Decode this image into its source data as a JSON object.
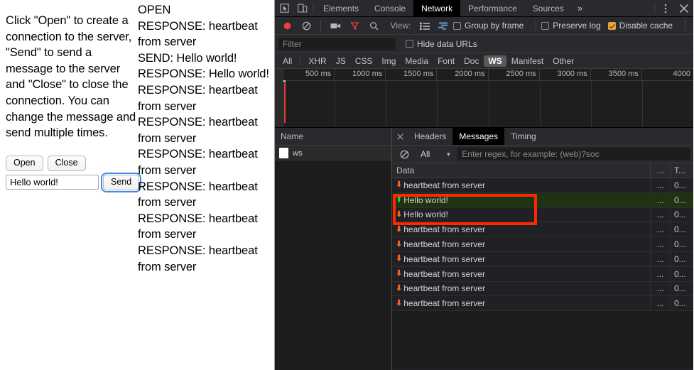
{
  "webpage": {
    "instructions": "Click \"Open\" to create a connection to the server, \"Send\" to send a message to the server and \"Close\" to close the connection. You can change the message and send multiple times.",
    "buttons": {
      "open": "Open",
      "close": "Close",
      "send": "Send"
    },
    "message_input": {
      "value": "Hello world!",
      "placeholder": ""
    },
    "log_lines": [
      "OPEN",
      "RESPONSE: heartbeat from server",
      "SEND: Hello world!",
      "RESPONSE: Hello world!",
      "RESPONSE: heartbeat from server",
      "RESPONSE: heartbeat from server",
      "RESPONSE: heartbeat from server",
      "RESPONSE: heartbeat from server",
      "RESPONSE: heartbeat from server",
      "RESPONSE: heartbeat from server"
    ]
  },
  "devtools": {
    "main_tabs": [
      {
        "label": "Elements",
        "active": false
      },
      {
        "label": "Console",
        "active": false
      },
      {
        "label": "Network",
        "active": true
      },
      {
        "label": "Performance",
        "active": false
      },
      {
        "label": "Sources",
        "active": false
      }
    ],
    "more_tabs_label": "»",
    "icons": {
      "inspect": "inspect-element-icon",
      "device": "device-toolbar-icon",
      "menu": "kebab-menu-icon",
      "close": "close-devtools-icon",
      "record": "record-icon",
      "clear": "clear-icon",
      "screenshot": "camera-icon",
      "filter": "filter-icon",
      "search": "search-icon"
    },
    "toolbar": {
      "view_label": "View:",
      "group_by_frame": {
        "label": "Group by frame",
        "checked": false
      },
      "preserve_log": {
        "label": "Preserve log",
        "checked": false
      },
      "disable_cache": {
        "label": "Disable cache",
        "checked": true
      }
    },
    "filter": {
      "placeholder": "Filter",
      "value": "",
      "hide_data_urls": {
        "label": "Hide data URLs",
        "checked": false
      }
    },
    "resource_types": [
      {
        "label": "All",
        "active": false
      },
      {
        "label": "XHR",
        "active": false
      },
      {
        "label": "JS",
        "active": false
      },
      {
        "label": "CSS",
        "active": false
      },
      {
        "label": "Img",
        "active": false
      },
      {
        "label": "Media",
        "active": false
      },
      {
        "label": "Font",
        "active": false
      },
      {
        "label": "Doc",
        "active": false
      },
      {
        "label": "WS",
        "active": true
      },
      {
        "label": "Manifest",
        "active": false
      },
      {
        "label": "Other",
        "active": false
      }
    ],
    "overview_ticks": [
      "500 ms",
      "1000 ms",
      "1500 ms",
      "2000 ms",
      "2500 ms",
      "3000 ms",
      "3500 ms",
      "4000"
    ],
    "requests_panel": {
      "column_header": "Name",
      "rows": [
        {
          "name": "ws",
          "selected": true
        }
      ]
    },
    "detail_panel": {
      "tabs": [
        {
          "label": "Headers",
          "active": false
        },
        {
          "label": "Messages",
          "active": true
        },
        {
          "label": "Timing",
          "active": false
        }
      ],
      "message_filter": {
        "type_label": "All",
        "regex_placeholder": "Enter regex, for example: (web)?soc",
        "regex_value": ""
      },
      "columns": {
        "data": "Data",
        "length": "...",
        "time": "T..."
      },
      "messages": [
        {
          "direction": "receive",
          "data": "heartbeat from server",
          "length": "...",
          "time": "0...",
          "highlighted": false
        },
        {
          "direction": "send",
          "data": "Hello world!",
          "length": "...",
          "time": "0...",
          "highlighted": true
        },
        {
          "direction": "receive",
          "data": "Hello world!",
          "length": "...",
          "time": "0...",
          "highlighted": true
        },
        {
          "direction": "receive",
          "data": "heartbeat from server",
          "length": "...",
          "time": "0...",
          "highlighted": false
        },
        {
          "direction": "receive",
          "data": "heartbeat from server",
          "length": "...",
          "time": "0...",
          "highlighted": false
        },
        {
          "direction": "receive",
          "data": "heartbeat from server",
          "length": "...",
          "time": "0...",
          "highlighted": false
        },
        {
          "direction": "receive",
          "data": "heartbeat from server",
          "length": "...",
          "time": "0...",
          "highlighted": false
        },
        {
          "direction": "receive",
          "data": "heartbeat from server",
          "length": "...",
          "time": "0...",
          "highlighted": false
        },
        {
          "direction": "receive",
          "data": "heartbeat from server",
          "length": "...",
          "time": "0...",
          "highlighted": false
        }
      ]
    },
    "colors": {
      "background": "#202124",
      "toolbar": "#292a2d",
      "sent_row": "#1d3311",
      "receive_arrow": "#f26522",
      "send_arrow": "#2ecc40",
      "record_active": "#e8403a",
      "checkbox_checked": "#e8a33d",
      "annotation_box": "#ff2600"
    }
  }
}
